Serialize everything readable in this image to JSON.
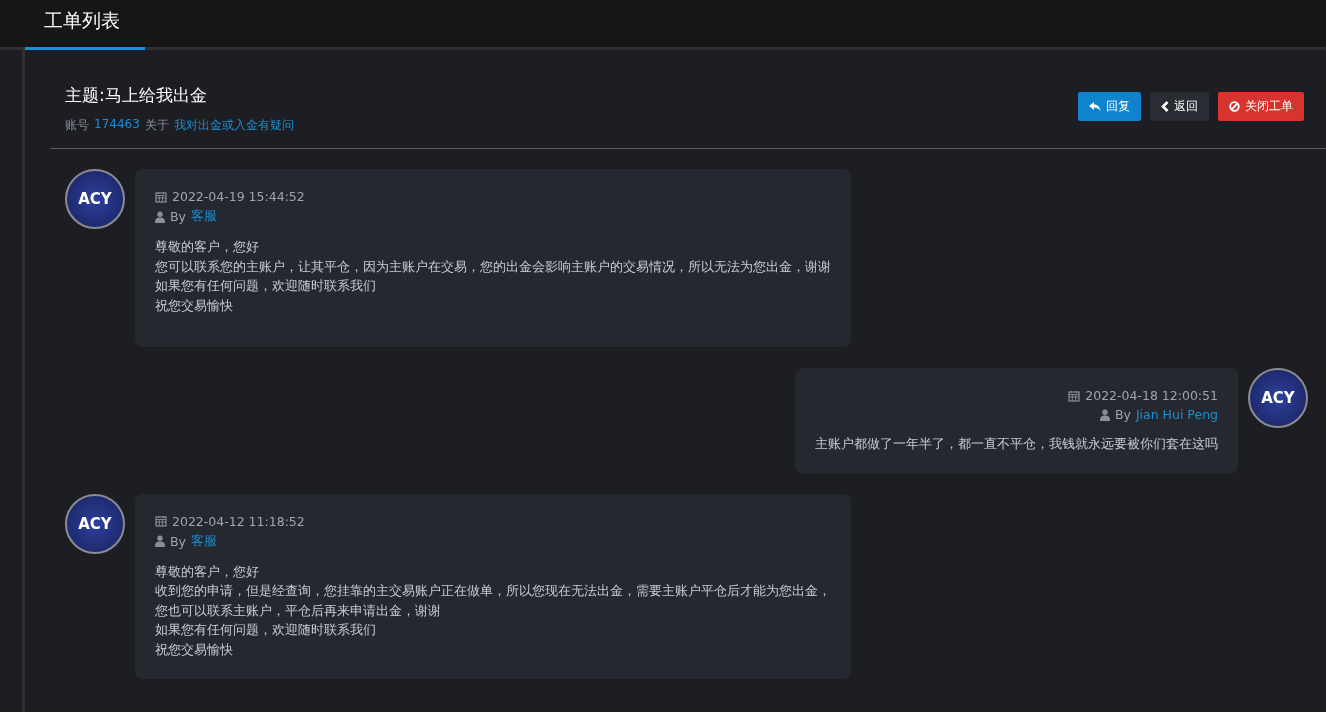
{
  "tabs": [
    {
      "label": "工单列表",
      "selected": true
    }
  ],
  "ticket": {
    "title": "主题:马上给我出金",
    "account_label": "账号",
    "account": "174463",
    "about_label": "关于",
    "category": "我对出金或入金有疑问"
  },
  "buttons": [
    {
      "kind": "reply",
      "label": "回复"
    },
    {
      "kind": "back",
      "label": "返回"
    },
    {
      "kind": "close",
      "label": "关闭工单"
    }
  ],
  "messages": [
    {
      "kind": "incoming",
      "avatar_text": "ACY",
      "time": "2022-04-19 15:44:52",
      "by_label": "By",
      "author": "客服",
      "lines": [
        "尊敬的客户，您好",
        "您可以联系您的主账户，让其平仓，因为主账户在交易，您的出金会影响主账户的交易情况，所以无法为您出金，谢谢",
        "如果您有任何问题，欢迎随时联系我们",
        "祝您交易愉快"
      ]
    },
    {
      "kind": "outgoing",
      "avatar_text": "ACY",
      "time": "2022-04-18 12:00:51",
      "by_label": "By",
      "author": "Jian Hui Peng",
      "lines": [
        "主账户都做了一年半了，都一直不平仓，我钱就永远要被你们套在这吗"
      ]
    },
    {
      "kind": "incoming",
      "avatar_text": "ACY",
      "time": "2022-04-12 11:18:52",
      "by_label": "By",
      "author": "客服",
      "lines": [
        "尊敬的客户，您好",
        "收到您的申请，但是经查询，您挂靠的主交易账户正在做单，所以您现在无法出金，需要主账户平仓后才能为您出金，您也可以联系主账户，平仓后再来申请出金，谢谢",
        "如果您有任何问题，欢迎随时联系我们",
        "祝您交易愉快"
      ]
    }
  ]
}
